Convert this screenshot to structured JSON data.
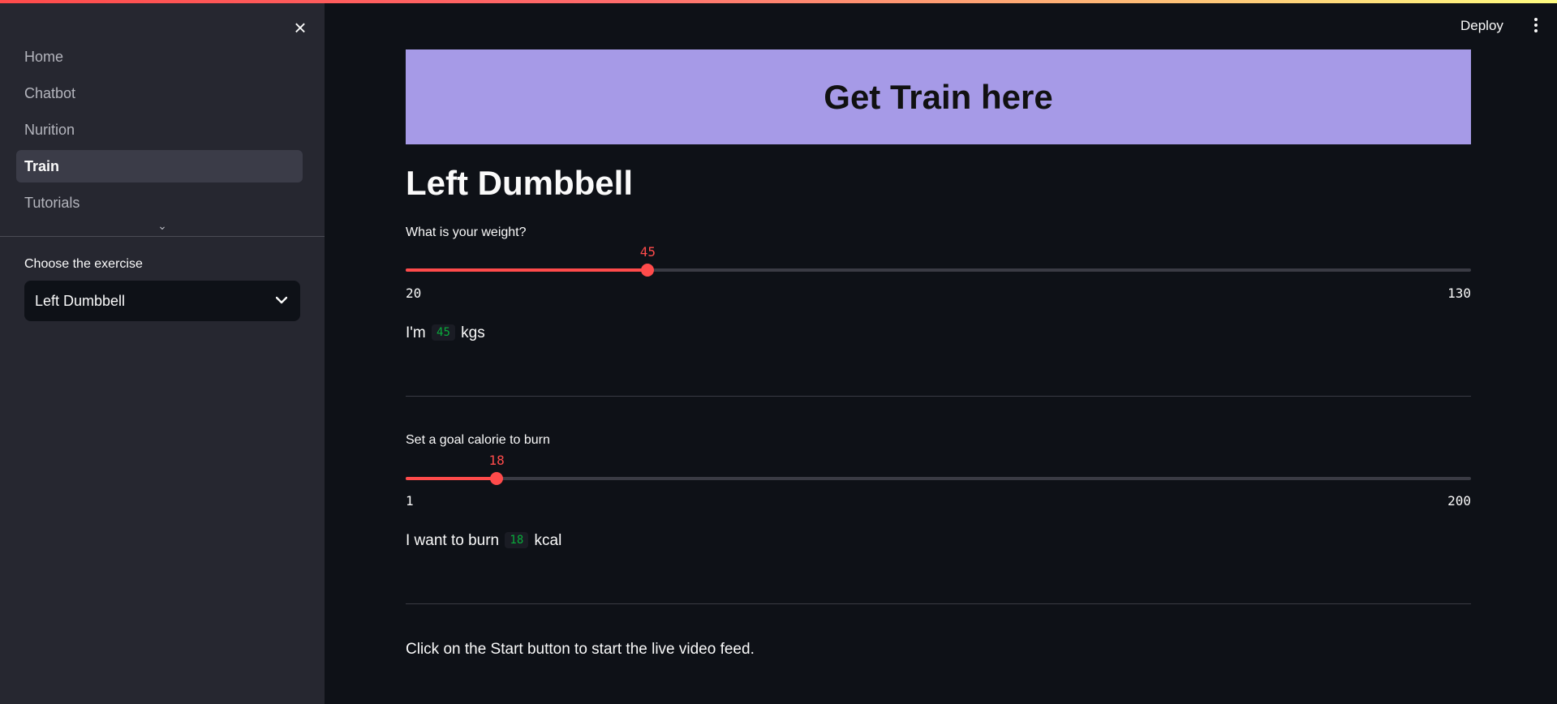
{
  "header": {
    "deploy_label": "Deploy",
    "menu_icon": "kebab-menu-icon",
    "gradient_colors": [
      "#ff4b4b",
      "#fffd80"
    ]
  },
  "sidebar": {
    "close_icon": "close-icon",
    "nav_items": [
      {
        "label": "Home",
        "active": false
      },
      {
        "label": "Chatbot",
        "active": false
      },
      {
        "label": "Nurition",
        "active": false
      },
      {
        "label": "Train",
        "active": true
      },
      {
        "label": "Tutorials",
        "active": false
      }
    ],
    "expand_icon": "chevron-down-icon",
    "select": {
      "label": "Choose the exercise",
      "value": "Left Dumbbell"
    }
  },
  "main": {
    "banner_text": "Get Train here",
    "banner_color": "#a69ae7",
    "title": "Left Dumbbell",
    "weight_slider": {
      "label": "What is your weight?",
      "min": 20,
      "max": 130,
      "value": 45,
      "min_label": "20",
      "max_label": "130",
      "value_label": "45"
    },
    "weight_sentence": {
      "prefix": "I'm",
      "value": "45",
      "suffix": "kgs"
    },
    "calorie_slider": {
      "label": "Set a goal calorie to burn",
      "min": 1,
      "max": 200,
      "value": 18,
      "min_label": "1",
      "max_label": "200",
      "value_label": "18"
    },
    "calorie_sentence": {
      "prefix": "I want to burn",
      "value": "18",
      "suffix": "kcal"
    },
    "info_text": "Click on the Start button to start the live video feed.",
    "accent_color": "#ff4b4b"
  }
}
